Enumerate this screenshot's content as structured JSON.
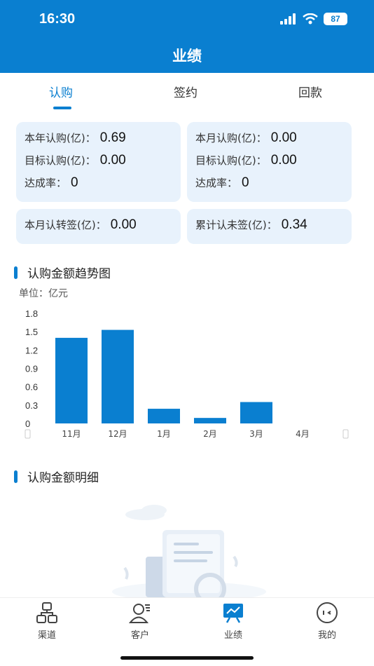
{
  "status": {
    "time": "16:30",
    "battery": "87"
  },
  "header": {
    "title": "业绩"
  },
  "tabs": [
    {
      "label": "认购",
      "active": true
    },
    {
      "label": "签约",
      "active": false
    },
    {
      "label": "回款",
      "active": false
    }
  ],
  "stats": {
    "year_sub_label": "本年认购(亿)：",
    "year_sub_value": "0.69",
    "year_target_label": "目标认购(亿)：",
    "year_target_value": "0.00",
    "year_rate_label": "达成率：",
    "year_rate_value": "0",
    "month_sub_label": "本月认购(亿)：",
    "month_sub_value": "0.00",
    "month_target_label": "目标认购(亿)：",
    "month_target_value": "0.00",
    "month_rate_label": "达成率：",
    "month_rate_value": "0",
    "month_convert_label": "本月认转签(亿)：",
    "month_convert_value": "0.00",
    "cumulative_unsigned_label": "累计认未签(亿)：",
    "cumulative_unsigned_value": "0.34"
  },
  "trend": {
    "title": "认购金额趋势图",
    "unit": "单位：亿元"
  },
  "detail": {
    "title": "认购金额明细"
  },
  "chart_data": {
    "type": "bar",
    "categories": [
      "11月",
      "12月",
      "1月",
      "2月",
      "3月",
      "4月"
    ],
    "values": [
      1.4,
      1.53,
      0.24,
      0.09,
      0.35,
      0
    ],
    "yticks": [
      "0",
      "0.3",
      "0.6",
      "0.9",
      "1.2",
      "1.5",
      "1.8"
    ],
    "ylim": [
      0,
      1.8
    ],
    "grid": false,
    "bar_color": "#0a7fd0"
  },
  "tabbar": [
    {
      "label": "渠道",
      "icon": "channel-icon",
      "active": false
    },
    {
      "label": "客户",
      "icon": "customer-icon",
      "active": false
    },
    {
      "label": "业绩",
      "icon": "performance-icon",
      "active": true
    },
    {
      "label": "我的",
      "icon": "profile-icon",
      "active": false
    }
  ],
  "colors": {
    "primary": "#0a7fd0",
    "card_bg": "#e8f2fc"
  }
}
